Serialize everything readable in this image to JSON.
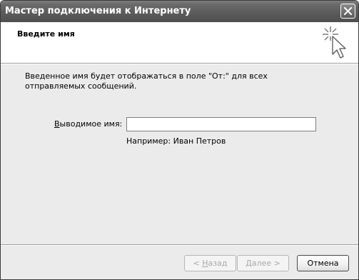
{
  "window": {
    "title": "Мастер подключения к Интернету"
  },
  "header": {
    "title": "Введите имя"
  },
  "body": {
    "description": "Введенное имя будет отображаться в поле \"От:\" для всех отправляемых сообщений.",
    "field_label_underlined": "В",
    "field_label_rest": "ыводимое имя:",
    "field_value": "",
    "hint": "Например: Иван Петров"
  },
  "buttons": {
    "back_prefix": "< ",
    "back_underlined": "Н",
    "back_rest": "азад",
    "next_underlined": "Д",
    "next_rest": "алее >",
    "cancel": "Отмена"
  },
  "icons": {
    "close": "close-icon",
    "wizard": "sparkle-cursor-icon"
  }
}
